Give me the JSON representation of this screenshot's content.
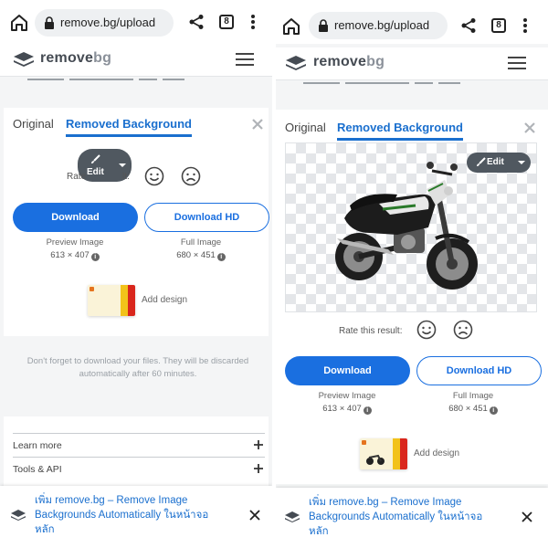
{
  "browser": {
    "url": "remove.bg/upload",
    "tab_count": "8"
  },
  "site": {
    "logo_primary": "remove",
    "logo_secondary": "bg"
  },
  "result_card": {
    "tab_original": "Original",
    "tab_removed": "Removed Background",
    "edit_label": "Edit",
    "rate_label": "Rate this result:",
    "rate_label_partial": "Rate",
    "rate_label_partial_end": "lt:",
    "download_label": "Download",
    "download_hd_label": "Download HD",
    "preview_caption": "Preview Image",
    "preview_dims": "613 × 407",
    "full_caption": "Full Image",
    "full_dims": "680 × 451",
    "add_design_label": "Add design"
  },
  "notice": {
    "line1": "Don't forget to download your files. They will be discarded",
    "line2": "automatically after 60 minutes."
  },
  "footer_links": [
    {
      "label": "Learn more"
    },
    {
      "label": "Tools & API"
    }
  ],
  "install_banner": {
    "line1": "เพิ่ม remove.bg – Remove Image",
    "line2": "Backgrounds Automatically ในหน้าจอ",
    "line3": "หลัก"
  },
  "colors": {
    "accent": "#1a6fe0",
    "tab_active": "#1a6fce",
    "edit_bg": "#505860"
  },
  "icons": [
    "home-icon",
    "lock-icon",
    "share-icon",
    "tabs-count-icon",
    "overflow-menu-icon",
    "logo-icon",
    "hamburger-icon",
    "close-icon",
    "brush-icon",
    "caret-down-icon",
    "smile-face-icon",
    "sad-face-icon",
    "info-icon",
    "plus-icon",
    "app-icon"
  ]
}
